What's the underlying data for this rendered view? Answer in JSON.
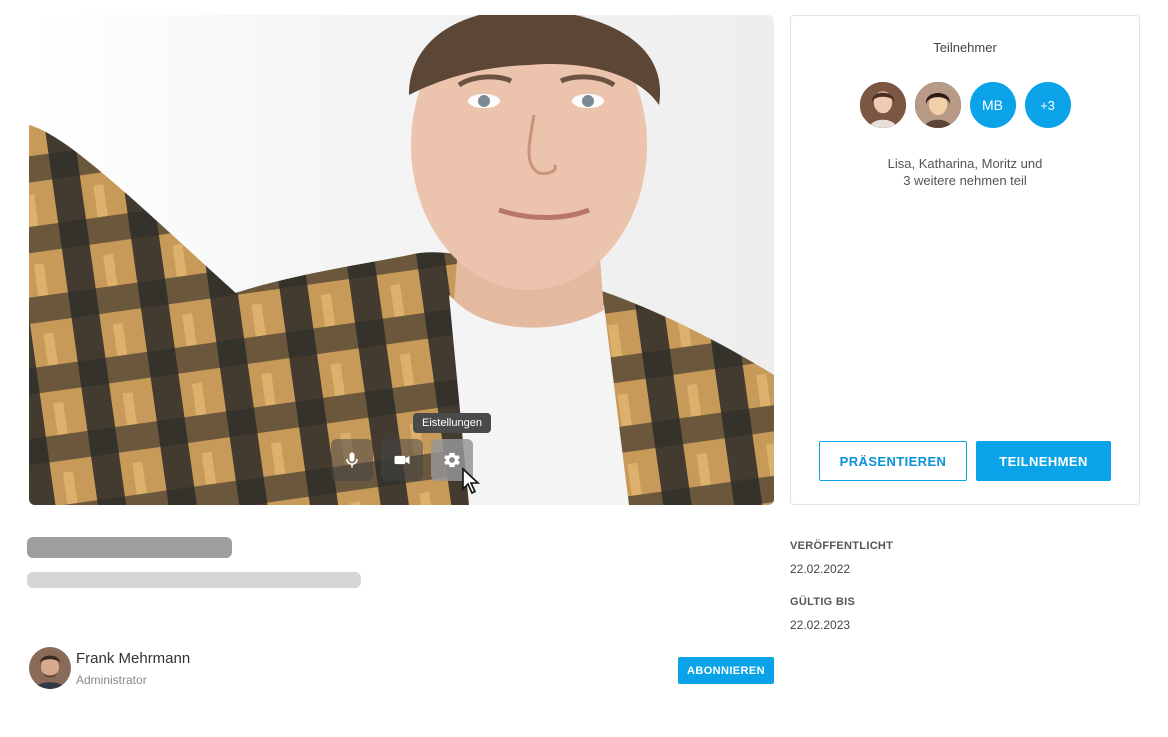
{
  "video": {
    "controls": [
      {
        "name": "microphone",
        "icon": "microphone-icon"
      },
      {
        "name": "camera",
        "icon": "video-camera-icon"
      },
      {
        "name": "settings",
        "icon": "gear-icon"
      }
    ],
    "tooltip": "Eistellungen"
  },
  "participants": {
    "title": "Teilnehmer",
    "avatars": [
      {
        "type": "photo",
        "icon": "participant-photo"
      },
      {
        "type": "photo",
        "icon": "participant-photo"
      },
      {
        "type": "initials",
        "text": "MB"
      },
      {
        "type": "more",
        "text": "+3"
      }
    ],
    "summary_line1": "Lisa, Katharina, Moritz und",
    "summary_line2": "3 weitere nehmen teil",
    "present_label": "PRÄSENTIEREN",
    "join_label": "TEILNEHMEN"
  },
  "meta": {
    "published_label": "VERÖFFENTLICHT",
    "published_value": "22.02.2022",
    "valid_label": "GÜLTIG BIS",
    "valid_value": "22.02.2023"
  },
  "author": {
    "name": "Frank Mehrmann",
    "role": "Administrator",
    "subscribe_label": "ABONNIEREN"
  },
  "colors": {
    "accent": "#0aa3ea"
  }
}
